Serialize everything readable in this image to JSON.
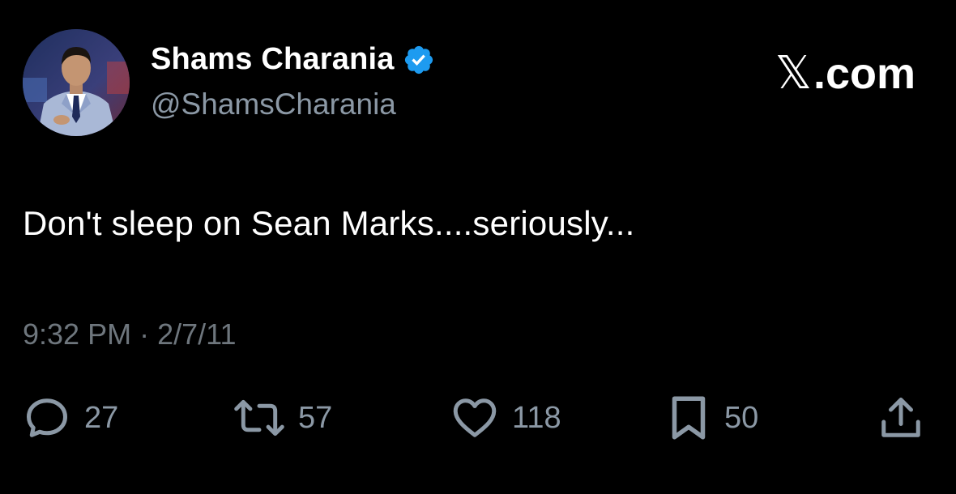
{
  "author": {
    "display_name": "Shams Charania",
    "handle": "@ShamsCharania",
    "verified": true
  },
  "brand": {
    "x_glyph": "𝕏",
    "suffix": ".com"
  },
  "tweet": {
    "text": "Don't sleep on Sean Marks....seriously...",
    "time": "9:32 PM",
    "separator": "·",
    "date": "2/7/11"
  },
  "metrics": {
    "replies": "27",
    "reposts": "57",
    "likes": "118",
    "bookmarks": "50"
  },
  "icons": {
    "reply": "speech-bubble-icon",
    "repost": "repost-arrows-icon",
    "like": "heart-icon",
    "bookmark": "bookmark-icon",
    "share": "share-upload-icon",
    "verified": "verified-badge-icon"
  },
  "colors": {
    "background": "#000000",
    "text_primary": "#ffffff",
    "text_secondary": "#8b98a5",
    "timestamp": "#6e767d",
    "verified_blue": "#1d9bf0"
  }
}
